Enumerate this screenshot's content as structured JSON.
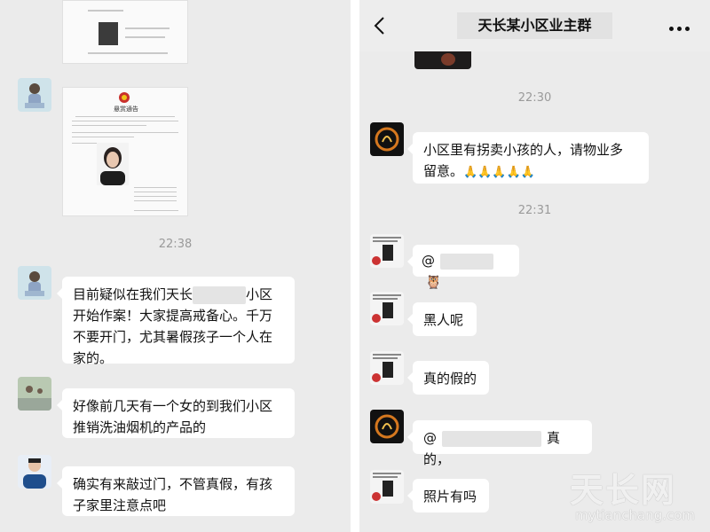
{
  "left_chat": {
    "timestamp": "22:38",
    "notice": {
      "title": "悬赏通告"
    },
    "messages": [
      {
        "line1a": "目前疑似在我们天长",
        "line1b": "小区",
        "line2": "开始作案！大家提高戒备心。千万",
        "line3": "不要开门，尤其暑假孩子一个人在",
        "line4": "家的。"
      },
      {
        "line1": "好像前几天有一个女的到我们小区",
        "line2": "推销洗油烟机的产品的"
      },
      {
        "line1": "确实有来敲过门，不管真假，有孩",
        "line2": "子家里注意点吧"
      }
    ]
  },
  "right_chat": {
    "header": {
      "title": "天长某小区业主群"
    },
    "timestamp1": "22:30",
    "timestamp2": "22:31",
    "messages": [
      {
        "line1": "小区里有拐卖小孩的人，请物业多",
        "line2": "留意。",
        "emoji": "🙏🙏🙏🙏🙏"
      },
      {
        "text": "@",
        "emoji": "🦉"
      },
      {
        "text": "黑人呢"
      },
      {
        "text": "真的假的"
      },
      {
        "text_a": "@",
        "text_b": "真的，"
      },
      {
        "text": "照片有吗"
      }
    ]
  },
  "watermark": {
    "main": "天长网",
    "sub": "mytianchang.com"
  }
}
